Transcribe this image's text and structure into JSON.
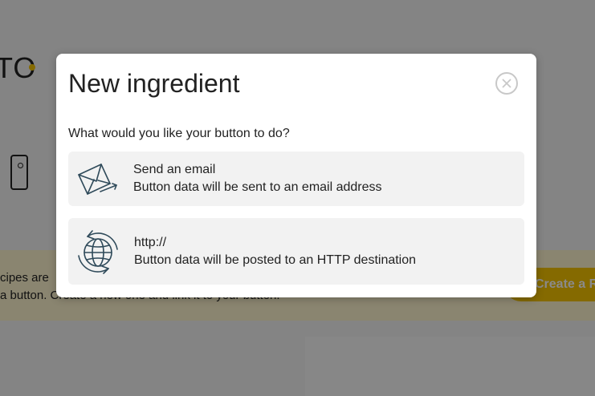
{
  "background": {
    "logo_text": "TO",
    "banner_line1": "cipes are",
    "banner_line2": "a button. Create a new one and link it to your button.",
    "create_button_label": "Create a R"
  },
  "modal": {
    "title": "New ingredient",
    "prompt": "What would you like your button to do?",
    "options": [
      {
        "title": "Send an email",
        "description": "Button data will be sent to an email address",
        "icon": "email-icon"
      },
      {
        "title": "http://",
        "description": "Button data will be posted to an HTTP destination",
        "icon": "globe-sync-icon"
      }
    ],
    "close_icon": "close-icon"
  },
  "colors": {
    "accent": "#f5c400",
    "icon_stroke": "#2f4a5a",
    "option_bg": "#f2f2f2"
  }
}
